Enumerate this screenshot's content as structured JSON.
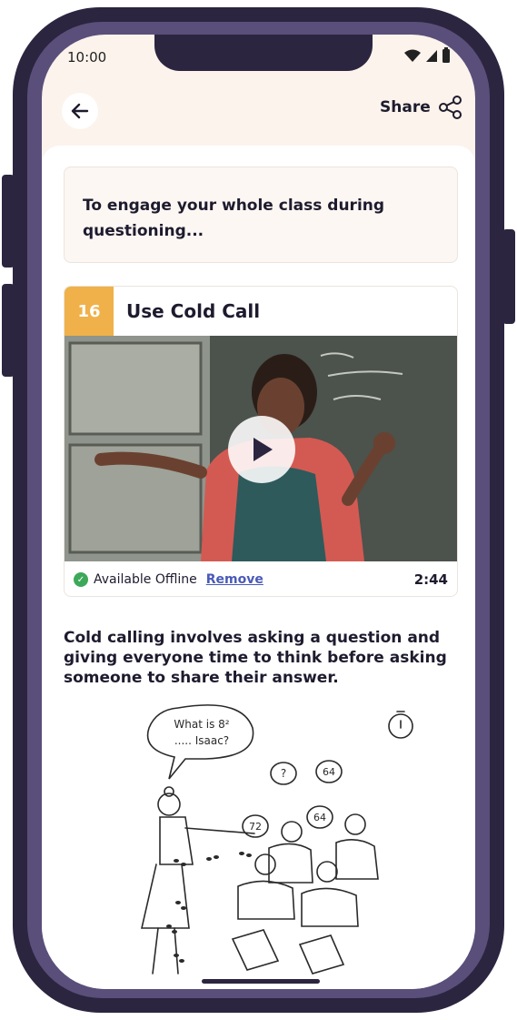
{
  "status_bar": {
    "time": "10:00"
  },
  "header": {
    "share_label": "Share"
  },
  "intro": {
    "text": "To engage your whole class during questioning..."
  },
  "technique": {
    "number": "16",
    "title": "Use Cold Call",
    "offline_label": "Available Offline",
    "remove_label": "Remove",
    "duration": "2:44"
  },
  "description": "Cold calling involves asking a question and giving everyone time to think before asking someone to share their answer.",
  "illustration": {
    "speech_line1": "What is 8²",
    "speech_line2": "..... Isaac?",
    "bubble_question": "?",
    "bubble_a": "64",
    "bubble_b": "72",
    "bubble_c": "64"
  },
  "colors": {
    "accent": "#f0b14a",
    "frame": "#2c2540",
    "offline": "#3da85a",
    "link": "#4a5ab8"
  }
}
